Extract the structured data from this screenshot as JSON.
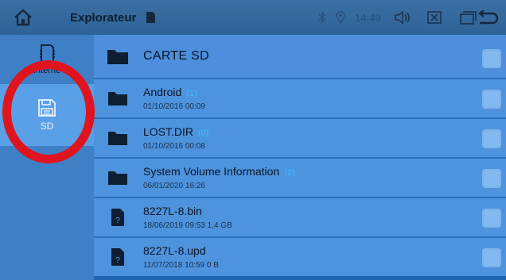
{
  "topbar": {
    "title": "Explorateur",
    "time": "14:49"
  },
  "sidebar": {
    "items": [
      {
        "label": "Interne",
        "icon": "sd-card-icon",
        "active": false
      },
      {
        "label": "SD",
        "icon": "floppy-disk-icon",
        "active": true
      }
    ]
  },
  "main": {
    "header": {
      "label": "CARTE SD"
    },
    "rows": [
      {
        "name": "Android",
        "count": "(1)",
        "meta": "01/10/2016 00:09",
        "type": "folder"
      },
      {
        "name": "LOST.DIR",
        "count": "(0)",
        "meta": "01/10/2016 00:08",
        "type": "folder"
      },
      {
        "name": "System Volume Information",
        "count": "(2)",
        "meta": "06/01/2020 16:26",
        "type": "folder"
      },
      {
        "name": "8227L-8.bin",
        "count": "",
        "meta": "18/06/2019 09:53  1,4 GB",
        "type": "file"
      },
      {
        "name": "8227L-8.upd",
        "count": "",
        "meta": "11/07/2018 10:59  0 B",
        "type": "file"
      }
    ]
  },
  "colors": {
    "topbar": "#2f6398",
    "sidebar": "#3f7fc6",
    "sidebar_active": "#5aa0e6",
    "row": "#4e93de",
    "count_accent": "#2fc3ff",
    "highlight_ring": "#e0141f"
  }
}
